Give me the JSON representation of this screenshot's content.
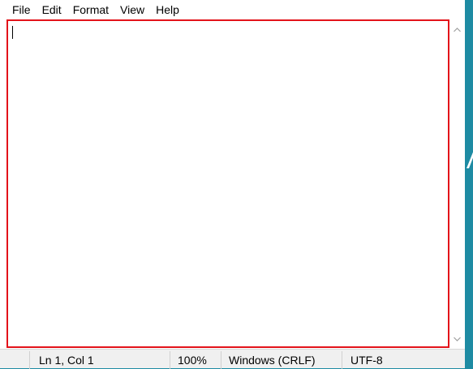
{
  "menu": {
    "items": [
      "File",
      "Edit",
      "Format",
      "View",
      "Help"
    ]
  },
  "editor": {
    "content": ""
  },
  "status": {
    "position": "Ln 1, Col 1",
    "zoom": "100%",
    "line_ending": "Windows (CRLF)",
    "encoding": "UTF-8"
  },
  "colors": {
    "desktop": "#1e8ba3",
    "highlight_border": "#e3131a",
    "statusbar": "#f0f0f0"
  },
  "icons": {
    "scroll_up": "chevron-up-icon",
    "scroll_down": "chevron-down-icon"
  }
}
